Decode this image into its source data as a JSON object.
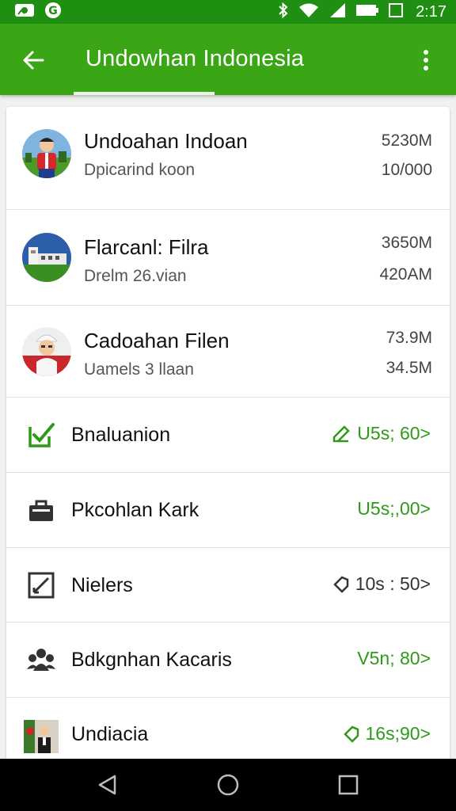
{
  "status_bar": {
    "time": "2:17",
    "icons": [
      "notification-icon",
      "app-icon",
      "bluetooth-icon",
      "wifi-icon",
      "signal-icon",
      "battery-icon"
    ]
  },
  "app_bar": {
    "title": "Undowhan Indonesia",
    "back_icon": "arrow-back-icon",
    "menu_icon": "more-vert-icon"
  },
  "accounts": [
    {
      "title": "Undoahan Indoan",
      "subtitle": "Dpicarind koon",
      "value1": "5230M",
      "value2": "10/000",
      "avatar": "person-avatar-red"
    },
    {
      "title": "Flarcanl: Filra",
      "subtitle": "Drelm 26.vian",
      "value1": "3650M",
      "value2": "420AM",
      "avatar": "building-avatar"
    },
    {
      "title": "Cadoahan Filen",
      "subtitle": "Uamels 3 llaan",
      "value1": "73.9M",
      "value2": "34.5M",
      "avatar": "person-avatar-white"
    }
  ],
  "sections": [
    {
      "label": "Bnaluanion",
      "value": "U5s; 60>",
      "icon": "check-shield-icon",
      "value_icon": "edit-icon",
      "value_color": "#2e9a18"
    },
    {
      "label": "Pkcohlan  Kark",
      "value": "U5s;,00>",
      "icon": "briefcase-icon",
      "value_icon": "",
      "value_color": "#2e9a18"
    },
    {
      "label": "Nielers",
      "value": "10s : 50>",
      "icon": "edit-box-icon",
      "value_icon": "tag-icon",
      "value_color": "#333333"
    },
    {
      "label": "Bdkgnhan Kacaris",
      "value": "V5n; 80>",
      "icon": "people-icon",
      "value_icon": "",
      "value_color": "#2e9a18"
    },
    {
      "label": "Undiacia",
      "value": "16s;90>",
      "icon": "photo-thumb-icon",
      "value_icon": "tag-icon",
      "value_color": "#2e9a18"
    }
  ],
  "nav_bar": {
    "icons": [
      "nav-back-icon",
      "nav-home-icon",
      "nav-recents-icon"
    ]
  },
  "colors": {
    "status_bar": "#1f8f12",
    "app_bar": "#3aa616",
    "accent": "#2e9a18"
  }
}
